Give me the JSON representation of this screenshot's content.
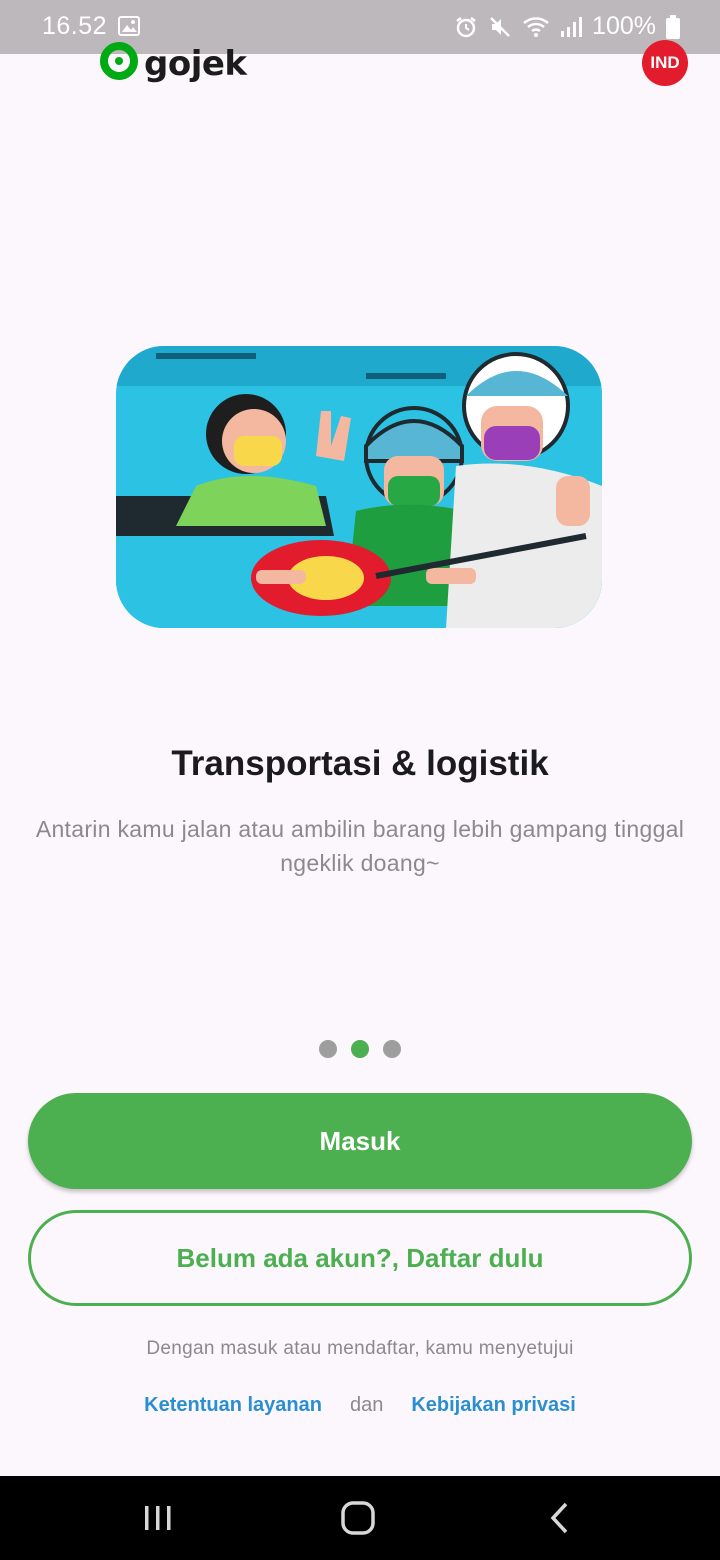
{
  "status_bar": {
    "time": "16.52",
    "battery": "100%",
    "icons": [
      "image-icon",
      "alarm-icon",
      "mute-icon",
      "wifi-icon",
      "signal-icon",
      "battery-icon"
    ]
  },
  "header": {
    "logo_text": "gojek",
    "language": "IND",
    "colors": {
      "logo_green": "#00aa13",
      "badge_red": "#e21b2d"
    }
  },
  "onboarding": {
    "title": "Transportasi & logistik",
    "subtitle": "Antarin kamu jalan atau ambilin barang lebih gampang tinggal ngeklik doang~",
    "slides_total": 3,
    "active_slide": 2
  },
  "actions": {
    "login_label": "Masuk",
    "register_label": "Belum ada akun?, Daftar dulu",
    "accent": "#4caf50"
  },
  "legal": {
    "text": "Dengan masuk atau mendaftar, kamu menyetujui",
    "terms_link": "Ketentuan layanan",
    "and": "dan",
    "privacy_link": "Kebijakan privasi"
  },
  "nav_bar": {
    "icons": [
      "recent-apps-icon",
      "home-icon",
      "back-icon"
    ]
  }
}
